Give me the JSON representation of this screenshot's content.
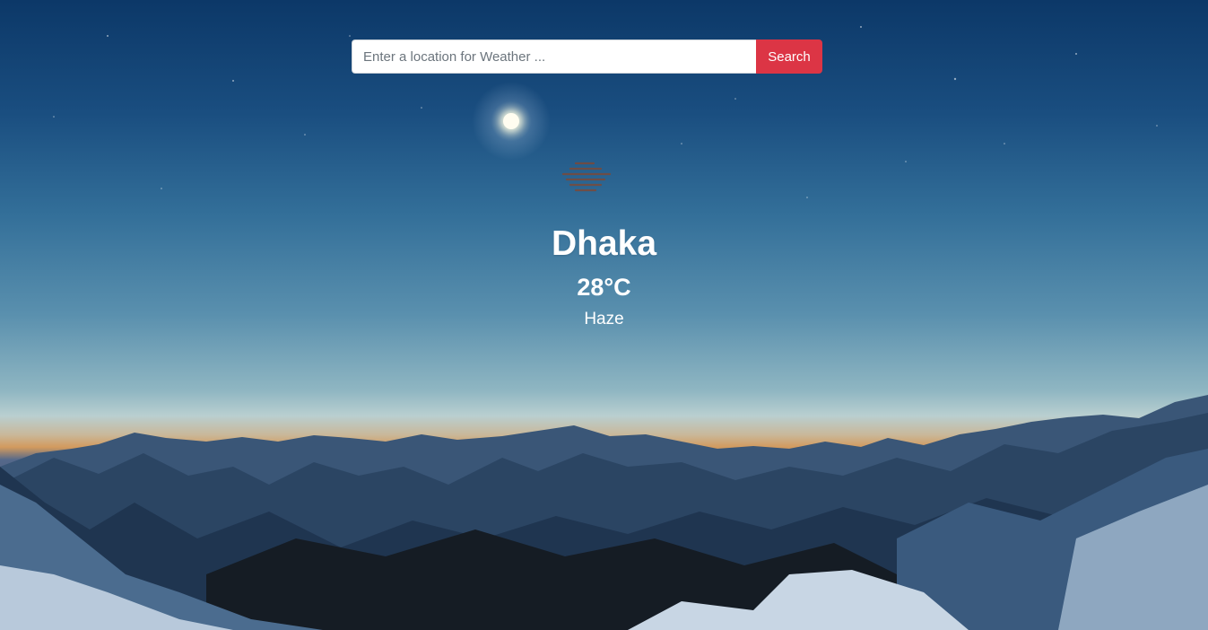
{
  "search": {
    "placeholder": "Enter a location for Weather ...",
    "value": "",
    "button_label": "Search"
  },
  "weather": {
    "icon": "haze-icon",
    "city": "Dhaka",
    "temperature": "28°C",
    "condition": "Haze"
  },
  "colors": {
    "accent": "#dc3545",
    "icon_color": "#7a4a3a",
    "text": "#ffffff"
  }
}
